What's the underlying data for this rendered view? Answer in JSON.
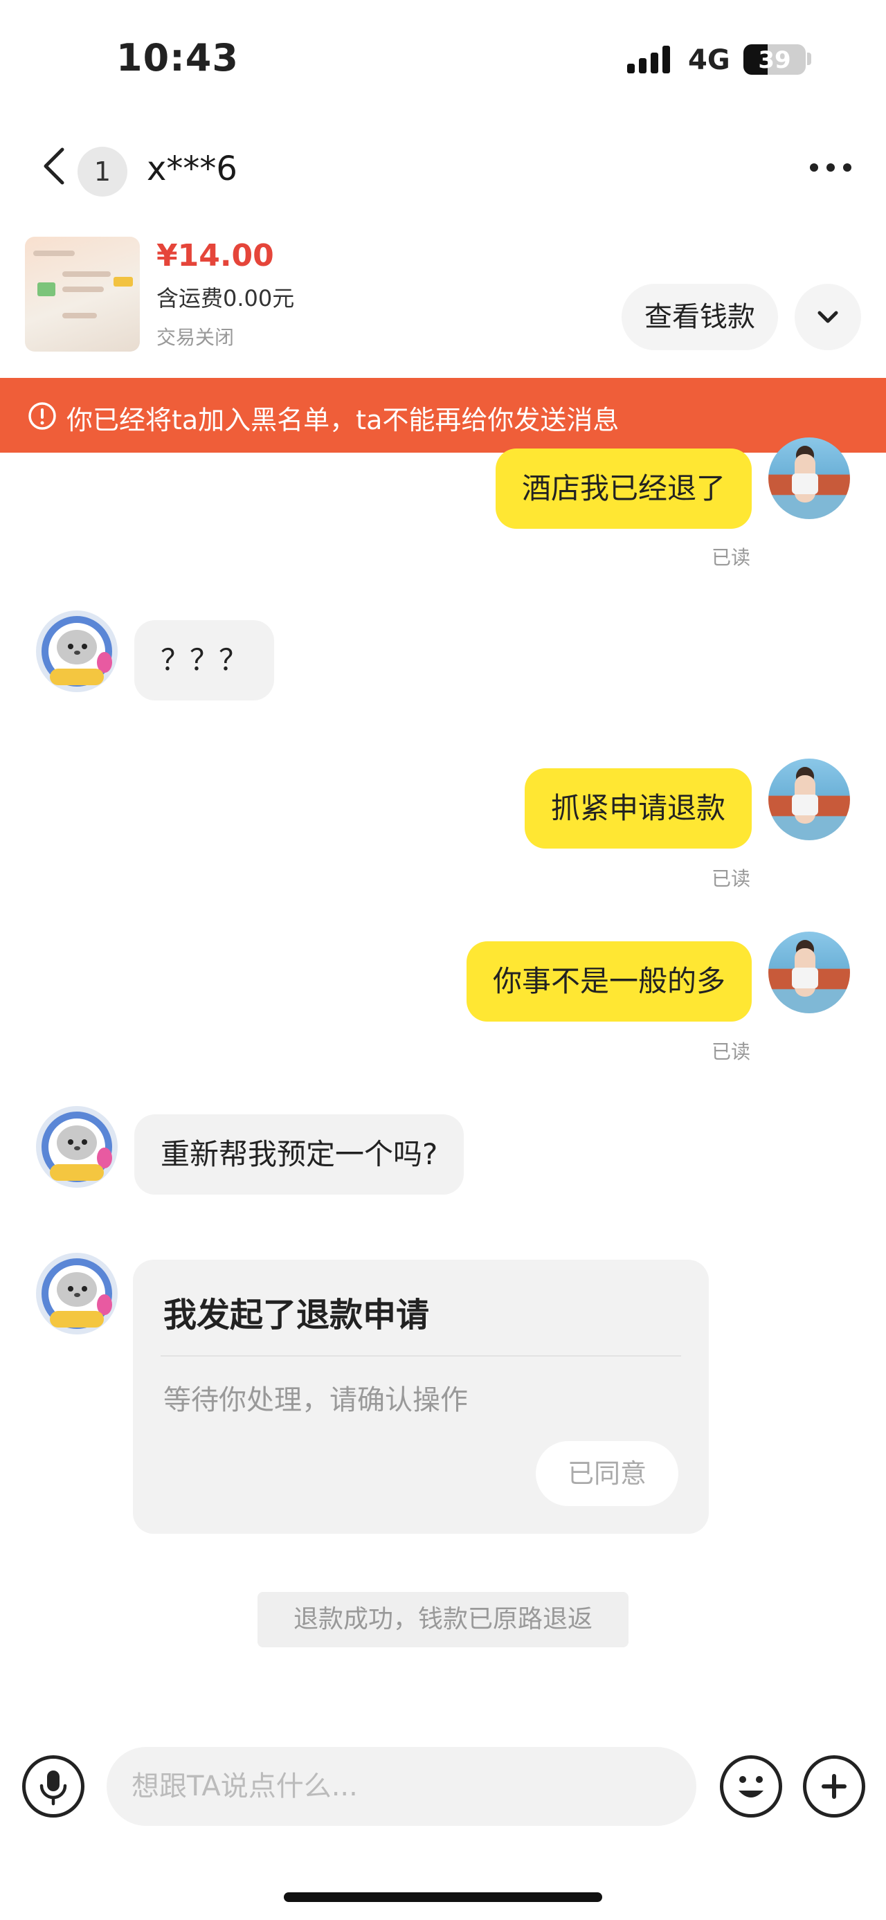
{
  "status_bar": {
    "time": "10:43",
    "network": "4G",
    "battery": "39",
    "battery_level_percent": 39
  },
  "nav": {
    "unread_count": "1",
    "peer_name": "x***6"
  },
  "product": {
    "price": "¥14.00",
    "shipping": "含运费0.00元",
    "trade_status": "交易关闭",
    "view_money_label": "查看钱款"
  },
  "banner": {
    "text": "你已经将ta加入黑名单，ta不能再给你发送消息",
    "color": "#ef5e39"
  },
  "messages": [
    {
      "from": "me",
      "text": "酒店我已经退了",
      "status": "已读"
    },
    {
      "from": "peer",
      "text": "？？？"
    },
    {
      "from": "me",
      "text": "抓紧申请退款",
      "status": "已读"
    },
    {
      "from": "me",
      "text": "你事不是一般的多",
      "status": "已读"
    },
    {
      "from": "peer",
      "text": "重新帮我预定一个吗?"
    }
  ],
  "refund_card": {
    "title": "我发起了退款申请",
    "description": "等待你处理，请确认操作",
    "button_label": "已同意"
  },
  "system_notice": "退款成功，钱款已原路退返",
  "input": {
    "placeholder": "想跟TA说点什么..."
  },
  "icons": {
    "back": "chevron-left-icon",
    "more": "more-icon",
    "expand": "chevron-down-icon",
    "alert": "alert-circle-icon",
    "mic": "microphone-icon",
    "emoji": "emoji-icon",
    "plus": "plus-icon"
  },
  "colors": {
    "self_bubble": "#ffe733",
    "peer_bubble": "#f2f2f2",
    "price": "#e5453a"
  }
}
